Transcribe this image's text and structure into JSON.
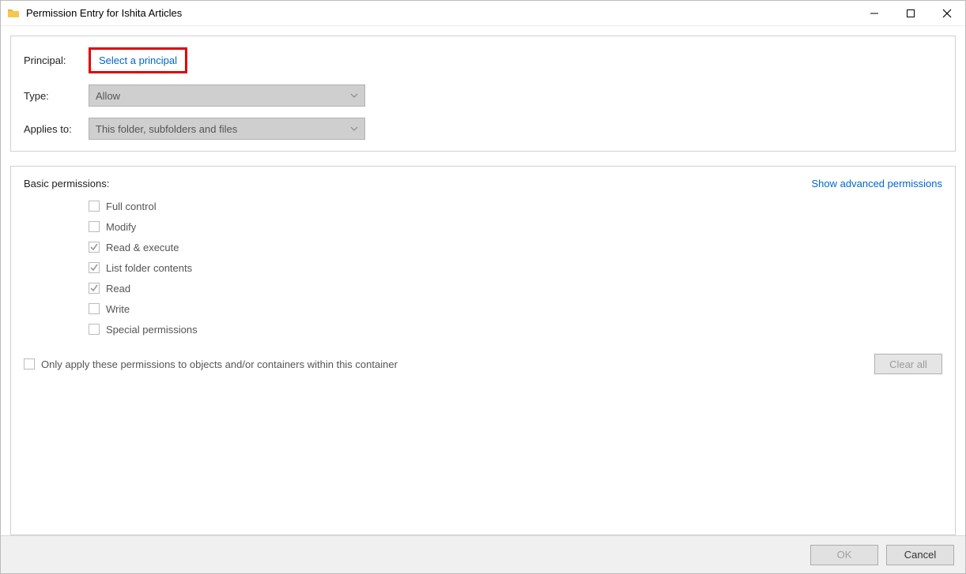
{
  "window": {
    "title": "Permission Entry for Ishita Articles"
  },
  "top": {
    "principal_label": "Principal:",
    "principal_link": "Select a principal",
    "type_label": "Type:",
    "type_value": "Allow",
    "applies_to_label": "Applies to:",
    "applies_to_value": "This folder, subfolders and files"
  },
  "perm": {
    "heading": "Basic permissions:",
    "show_advanced": "Show advanced permissions",
    "items": [
      {
        "label": "Full control",
        "checked": false
      },
      {
        "label": "Modify",
        "checked": false
      },
      {
        "label": "Read & execute",
        "checked": true
      },
      {
        "label": "List folder contents",
        "checked": true
      },
      {
        "label": "Read",
        "checked": true
      },
      {
        "label": "Write",
        "checked": false
      },
      {
        "label": "Special permissions",
        "checked": false
      }
    ],
    "only_apply_label": "Only apply these permissions to objects and/or containers within this container",
    "clear_all": "Clear all"
  },
  "footer": {
    "ok": "OK",
    "cancel": "Cancel"
  }
}
